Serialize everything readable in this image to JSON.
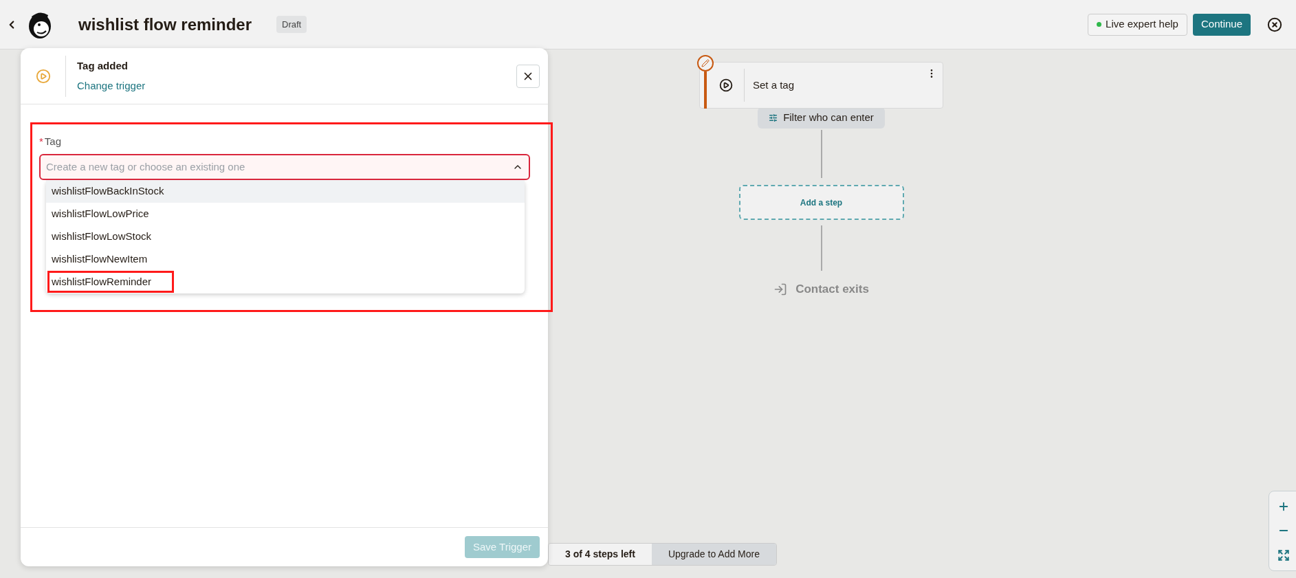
{
  "header": {
    "title": "wishlist flow reminder",
    "status": "Draft",
    "help_button": "Live expert help",
    "continue_button": "Continue"
  },
  "trigger_panel": {
    "trigger_name": "Tag added",
    "change_link": "Change trigger",
    "field": {
      "label": "Tag",
      "required_mark": "*",
      "placeholder": "Create a new tag or choose an existing one",
      "error": true,
      "expanded": true,
      "annotated": true
    },
    "options": [
      {
        "label": "wishlistFlowBackInStock",
        "highlighted": true,
        "annotated": false
      },
      {
        "label": "wishlistFlowLowPrice",
        "highlighted": false,
        "annotated": false
      },
      {
        "label": "wishlistFlowLowStock",
        "highlighted": false,
        "annotated": false
      },
      {
        "label": "wishlistFlowNewItem",
        "highlighted": false,
        "annotated": false
      },
      {
        "label": "wishlistFlowReminder",
        "highlighted": false,
        "annotated": true
      }
    ],
    "save_button": {
      "label": "Save Trigger",
      "disabled": true
    }
  },
  "canvas": {
    "step": {
      "title": "Set a tag",
      "editing": true
    },
    "filter_button": "Filter who can enter",
    "add_step": "Add a step",
    "exit": "Contact exits"
  },
  "steps_bar": {
    "remaining": "3 of 4 steps left",
    "upgrade": "Upgrade to Add More"
  }
}
